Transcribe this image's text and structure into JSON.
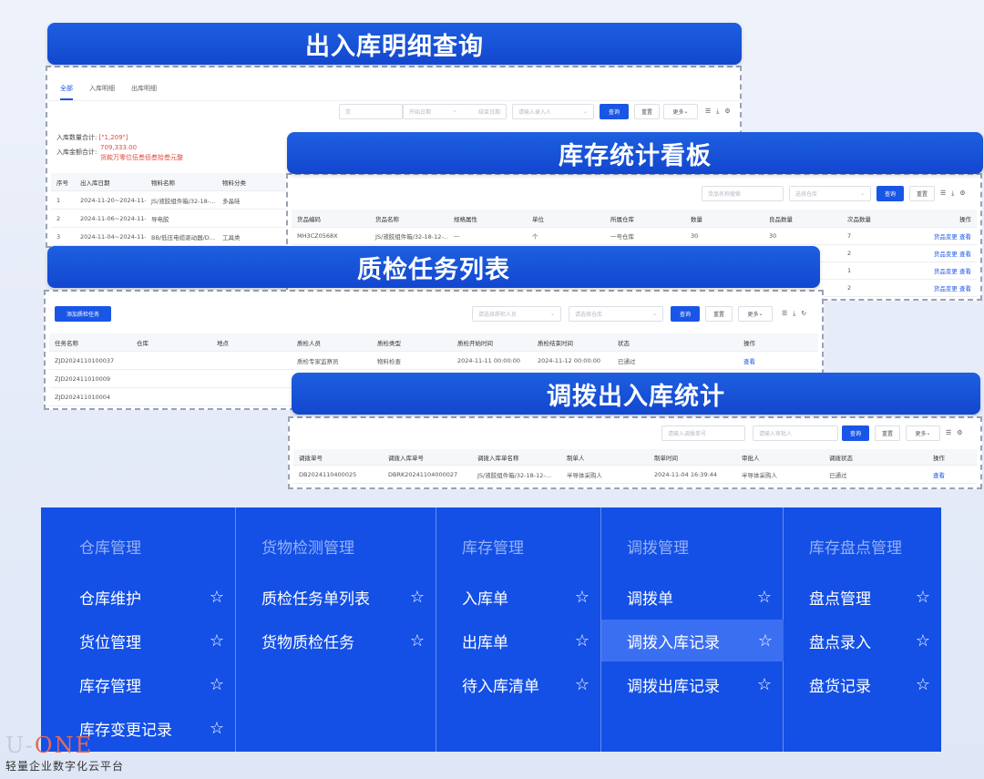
{
  "panel1": {
    "banner": "出入库明细查询",
    "tabs": [
      "全部",
      "入库明细",
      "出库明细"
    ],
    "filters": {
      "code": "货",
      "start_date": "开始日期",
      "sep": "~",
      "end_date": "结束日期",
      "recorder": "请输入录入人"
    },
    "buttons": {
      "query": "查询",
      "reset": "重置",
      "more": "更多"
    },
    "summary": {
      "qty_label": "入库数量合计:",
      "qty_value": "[\"1,209\"]",
      "amt_label": "入库金额合计:",
      "amt_value": "709,333.00",
      "amt_note": "货款万零位伍叁佰叁拾叁元整"
    },
    "columns": [
      "序号",
      "出入库日期",
      "物料名称",
      "物料分类"
    ],
    "rows": [
      [
        "1",
        "2024-11-20~2024-11-20",
        "JS/液胶组件箱/32-18-…",
        "多晶硅"
      ],
      [
        "2",
        "2024-11-06~2024-11-11",
        "导电胶",
        ""
      ],
      [
        "3",
        "2024-11-04~2024-11-04",
        "BB/低压电缆驱动器/D…",
        "工具类"
      ]
    ]
  },
  "panel2": {
    "banner": "库存统计看板",
    "filters": {
      "search": "货品名称搜索",
      "warehouse": "选择仓库"
    },
    "buttons": {
      "query": "查询",
      "reset": "重置"
    },
    "columns": [
      "货品编码",
      "货品名称",
      "规格属性",
      "单位",
      "所属仓库",
      "数量",
      "良品数量",
      "次品数量",
      "操作"
    ],
    "rows": [
      {
        "code": "MH3CZ0568X",
        "name": "JS/液胶组件箱/32-18-12-…",
        "spec": "—",
        "unit": "个",
        "warehouse": "一号仓库",
        "qty": "30",
        "good": "30",
        "bad": "7"
      },
      {
        "code": "",
        "name": "",
        "spec": "",
        "unit": "",
        "warehouse": "",
        "qty": "",
        "good": "",
        "bad": "2"
      },
      {
        "code": "",
        "name": "",
        "spec": "",
        "unit": "",
        "warehouse": "",
        "qty": "",
        "good": "",
        "bad": "1"
      },
      {
        "code": "",
        "name": "",
        "spec": "",
        "unit": "",
        "warehouse": "",
        "qty": "",
        "good": "",
        "bad": "2"
      }
    ],
    "ops": {
      "change": "货品变更",
      "view": "查看"
    }
  },
  "panel3": {
    "banner": "质检任务列表",
    "add_button": "添加质检任务",
    "filters": {
      "inspector": "请选择质检人员",
      "warehouse": "请选择仓库"
    },
    "buttons": {
      "query": "查询",
      "reset": "重置",
      "more": "更多"
    },
    "columns": [
      "任务名称",
      "仓库",
      "地点",
      "质检人员",
      "质检类型",
      "质检开始时间",
      "质检结束时间",
      "状态",
      "操作"
    ],
    "rows": [
      {
        "name": "ZJD2024110100037",
        "warehouse": "",
        "place": "",
        "inspector": "质检专家监察员",
        "type": "物料检查",
        "start": "2024-11-11 00:00:00",
        "end": "2024-11-12 00:00:00",
        "status": "已通过",
        "op": "查看"
      },
      {
        "name": "ZJD202411010009",
        "warehouse": "",
        "place": "",
        "inspector": "",
        "type": "",
        "start": "",
        "end": "",
        "status": "",
        "op": ""
      },
      {
        "name": "ZJD202411010004",
        "warehouse": "",
        "place": "",
        "inspector": "",
        "type": "",
        "start": "",
        "end": "",
        "status": "",
        "op": ""
      }
    ]
  },
  "panel4": {
    "banner": "调拨出入库统计",
    "filters": {
      "order": "请输入调拨单号",
      "approver": "请输入审批人"
    },
    "buttons": {
      "query": "查询",
      "reset": "重置",
      "more": "更多"
    },
    "columns": [
      "调拨单号",
      "调拨入库单号",
      "调拨入库单名称",
      "制单人",
      "制单时间",
      "审批人",
      "调拨状态",
      "操作"
    ],
    "rows": [
      {
        "no": "DB2024110400025",
        "in_no": "DBRK20241104000027",
        "in_name": "JS/液胶组件箱/32-18-12-…",
        "maker": "半导体采购人",
        "time": "2024-11-04 16:39:44",
        "approver": "半导体采购人",
        "status": "已通过",
        "op": "查看"
      }
    ]
  },
  "menu": {
    "columns": [
      {
        "title": "仓库管理",
        "items": [
          "仓库维护",
          "货位管理",
          "库存管理",
          "库存变更记录"
        ]
      },
      {
        "title": "货物检测管理",
        "items": [
          "质检任务单列表",
          "货物质检任务"
        ]
      },
      {
        "title": "库存管理",
        "items": [
          "入库单",
          "出库单",
          "待入库清单"
        ]
      },
      {
        "title": "调拨管理",
        "items": [
          "调拨单",
          "调拨入库记录",
          "调拨出库记录"
        ],
        "highlighted": 1
      },
      {
        "title": "库存盘点管理",
        "items": [
          "盘点管理",
          "盘点录入",
          "盘货记录"
        ]
      }
    ],
    "star_icon": "star-outline-icon"
  },
  "brand": {
    "logo_u": "U-",
    "logo_one": "ONE",
    "tagline": "轻量企业数字化云平台"
  }
}
